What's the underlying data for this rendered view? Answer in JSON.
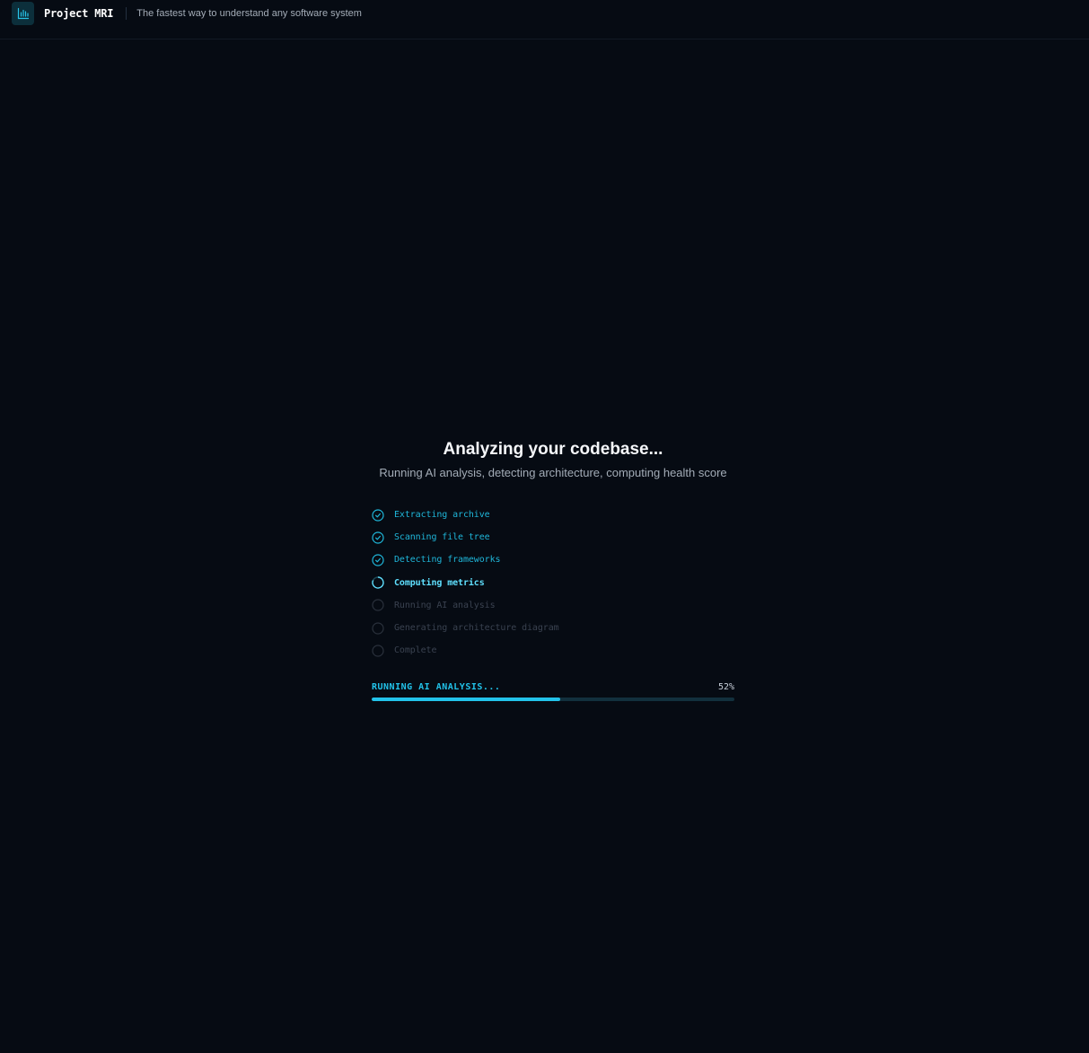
{
  "header": {
    "brand": "Project MRI",
    "tagline": "The fastest way to understand any software system",
    "logo_icon": "bar-chart-icon"
  },
  "main": {
    "title": "Analyzing your codebase...",
    "subtitle": "Running AI analysis, detecting architecture, computing health score",
    "steps": [
      {
        "label": "Extracting archive",
        "status": "done"
      },
      {
        "label": "Scanning file tree",
        "status": "done"
      },
      {
        "label": "Detecting frameworks",
        "status": "done"
      },
      {
        "label": "Computing metrics",
        "status": "active"
      },
      {
        "label": "Running AI analysis",
        "status": "pending"
      },
      {
        "label": "Generating architecture diagram",
        "status": "pending"
      },
      {
        "label": "Complete",
        "status": "pending"
      }
    ],
    "progress": {
      "label": "RUNNING AI ANALYSIS...",
      "percent_text": "52%",
      "value": 52
    }
  },
  "colors": {
    "background": "#060b13",
    "accent": "#22c3ea",
    "done_text": "#1fb6d9",
    "active_text": "#5fe0ff",
    "pending_text": "#3a4250"
  }
}
